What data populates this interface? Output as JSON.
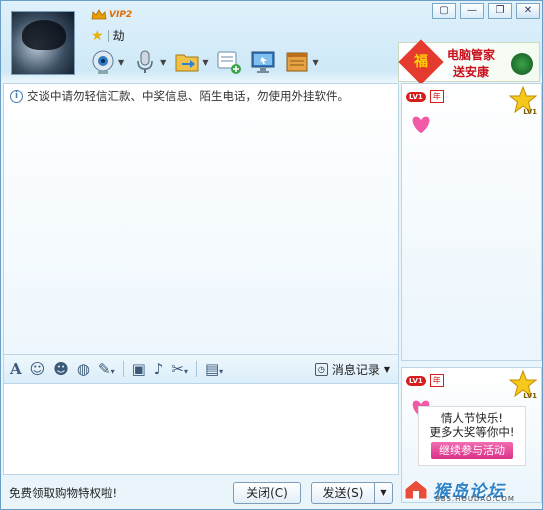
{
  "window": {
    "controls": [
      "▢",
      "—",
      "❐",
      "✕"
    ]
  },
  "header": {
    "vip_label": "VIP2",
    "nickname": "劫"
  },
  "toolbar": {
    "items": [
      {
        "name": "webcam",
        "has_dropdown": true
      },
      {
        "name": "microphone",
        "has_dropdown": true
      },
      {
        "name": "send-file",
        "has_dropdown": true
      },
      {
        "name": "chat-add",
        "has_dropdown": false
      },
      {
        "name": "remote-desktop",
        "has_dropdown": false
      },
      {
        "name": "app-box",
        "has_dropdown": true
      }
    ]
  },
  "ad": {
    "badge": "福",
    "line1": "电脑管家",
    "line2": "送安康"
  },
  "chat": {
    "notice": "交谈中请勿轻信汇款、中奖信息、陌生电话，勿使用外挂软件。"
  },
  "format_bar": {
    "history_label": "消息记录"
  },
  "input": {
    "value": "",
    "placeholder": ""
  },
  "bottom": {
    "promo_text": "免费领取购物特权啦!",
    "close_label": "关闭(C)",
    "send_label": "发送(S)"
  },
  "side": {
    "level_badge": "LV1",
    "year_badge": "年",
    "star_level": "LV1",
    "promo": {
      "line1": "情人节快乐!",
      "line2": "更多大奖等你中!",
      "cta": "继续参与活动"
    }
  },
  "watermark": {
    "title": "猴岛论坛",
    "sub": "BBS.HOUDAO.COM"
  },
  "colors": {
    "accent": "#2e83c9",
    "promo_pink": "#d9318a",
    "badge_red": "#d61c1c"
  }
}
